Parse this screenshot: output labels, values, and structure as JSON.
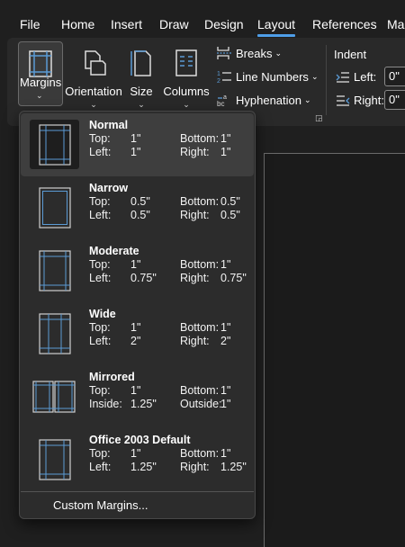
{
  "menu": {
    "tabs": [
      {
        "label": "File"
      },
      {
        "label": "Home"
      },
      {
        "label": "Insert"
      },
      {
        "label": "Draw"
      },
      {
        "label": "Design"
      },
      {
        "label": "Layout"
      },
      {
        "label": "References"
      },
      {
        "label": "Ma"
      }
    ],
    "active_tab": "Layout"
  },
  "ribbon": {
    "margins": {
      "label": "Margins",
      "icon": "margins-icon"
    },
    "orientation": {
      "label": "Orientation",
      "icon": "orientation-icon"
    },
    "size": {
      "label": "Size",
      "icon": "size-icon"
    },
    "columns": {
      "label": "Columns",
      "icon": "columns-icon"
    },
    "breaks": {
      "label": "Breaks",
      "icon": "breaks-icon"
    },
    "line_numbers": {
      "label": "Line Numbers",
      "icon": "line-numbers-icon"
    },
    "hyphenation": {
      "label": "Hyphenation",
      "icon": "hyphenation-icon"
    },
    "indent": {
      "title": "Indent",
      "left_label": "Left:",
      "left_value": "0\"",
      "right_label": "Right:",
      "right_value": "0\""
    }
  },
  "margin_presets": [
    {
      "name": "Normal",
      "top_label": "Top:",
      "top": "1\"",
      "bottom_label": "Bottom:",
      "bottom": "1\"",
      "left_label": "Left:",
      "left": "1\"",
      "right_label": "Right:",
      "right": "1\"",
      "selected": true
    },
    {
      "name": "Narrow",
      "top_label": "Top:",
      "top": "0.5\"",
      "bottom_label": "Bottom:",
      "bottom": "0.5\"",
      "left_label": "Left:",
      "left": "0.5\"",
      "right_label": "Right:",
      "right": "0.5\""
    },
    {
      "name": "Moderate",
      "top_label": "Top:",
      "top": "1\"",
      "bottom_label": "Bottom:",
      "bottom": "1\"",
      "left_label": "Left:",
      "left": "0.75\"",
      "right_label": "Right:",
      "right": "0.75\""
    },
    {
      "name": "Wide",
      "top_label": "Top:",
      "top": "1\"",
      "bottom_label": "Bottom:",
      "bottom": "1\"",
      "left_label": "Left:",
      "left": "2\"",
      "right_label": "Right:",
      "right": "2\""
    },
    {
      "name": "Mirrored",
      "top_label": "Top:",
      "top": "1\"",
      "bottom_label": "Bottom:",
      "bottom": "1\"",
      "left_label": "Inside:",
      "left": "1.25\"",
      "right_label": "Outside:",
      "right": "1\""
    },
    {
      "name": "Office 2003 Default",
      "top_label": "Top:",
      "top": "1\"",
      "bottom_label": "Bottom:",
      "bottom": "1\"",
      "left_label": "Left:",
      "left": "1.25\"",
      "right_label": "Right:",
      "right": "1.25\""
    }
  ],
  "custom_margins": {
    "label": "Custom Margins..."
  },
  "colors": {
    "accent": "#4f9ee8",
    "guide": "#5b9bd5"
  }
}
